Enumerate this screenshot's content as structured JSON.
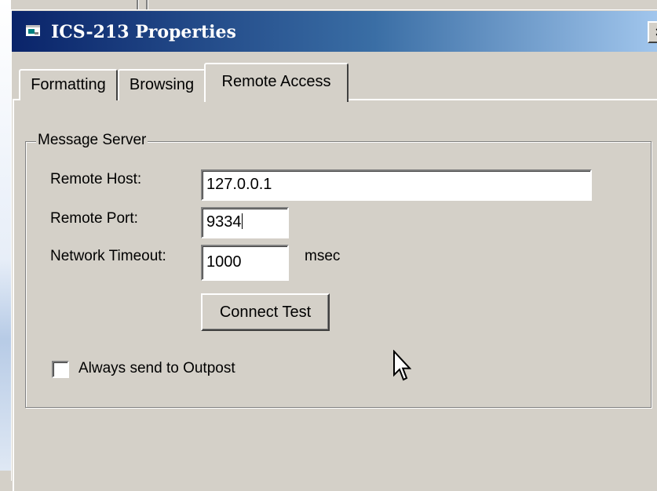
{
  "window": {
    "title": "ICS-213 Properties",
    "close_glyph": "×",
    "icon": "app-window-icon"
  },
  "tabs": [
    {
      "label": "Formatting",
      "selected": false
    },
    {
      "label": "Browsing",
      "selected": false
    },
    {
      "label": "Remote Access",
      "selected": true
    }
  ],
  "group": {
    "title": "Message Server",
    "remote_host_label": "Remote Host:",
    "remote_host_value": "127.0.0.1",
    "remote_port_label": "Remote Port:",
    "remote_port_value": "9334",
    "timeout_label": "Network Timeout:",
    "timeout_value": "1000",
    "timeout_unit": "msec",
    "connect_button": "Connect Test",
    "always_send_label": "Always send to Outpost",
    "always_send_checked": false
  },
  "colors": {
    "titlebar_start": "#0a246a",
    "titlebar_end": "#a6caf0",
    "face": "#d4d0c8"
  },
  "icons": [
    "app-window-icon",
    "close-icon",
    "mouse-pointer-icon"
  ]
}
